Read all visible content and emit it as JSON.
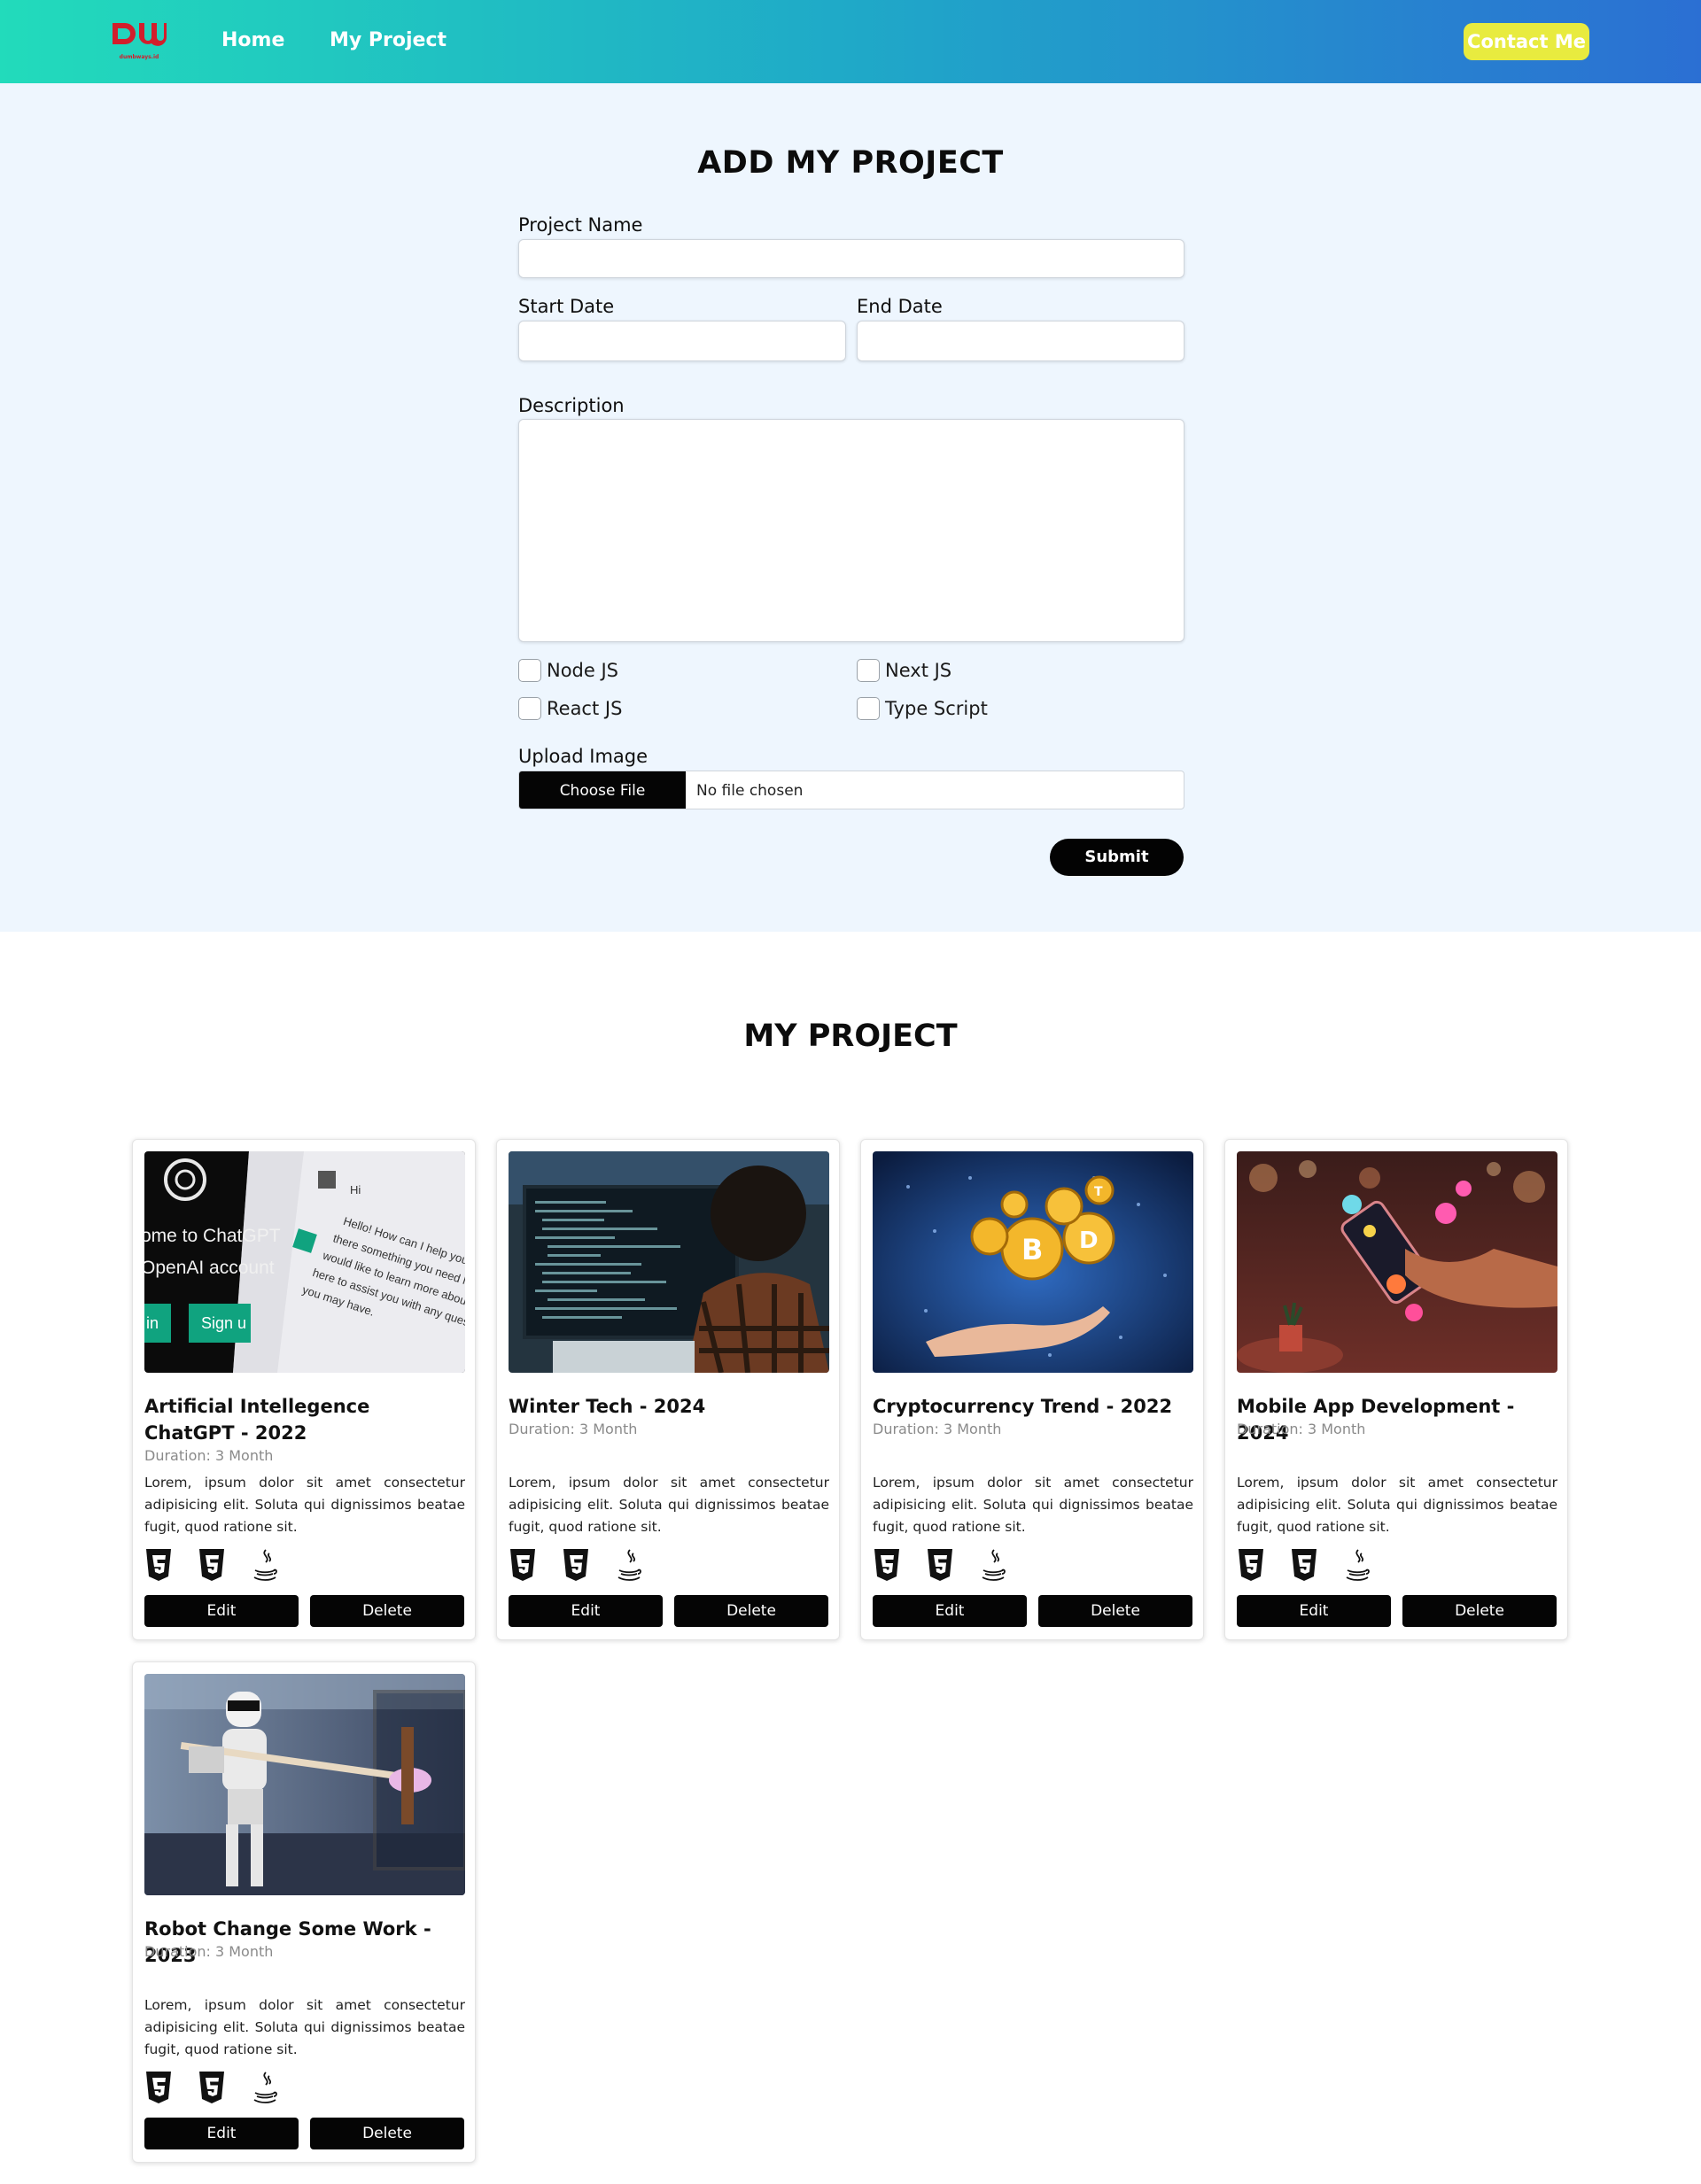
{
  "nav": {
    "logo_text": "dumbways.id",
    "home": "Home",
    "my_project": "My Project",
    "contact": "Contact Me"
  },
  "form": {
    "title": "ADD MY PROJECT",
    "project_name_label": "Project Name",
    "start_date_label": "Start Date",
    "end_date_label": "End Date",
    "description_label": "Description",
    "tech": [
      "Node JS",
      "Next JS",
      "React JS",
      "Type Script"
    ],
    "upload_label": "Upload Image",
    "choose_file": "Choose File",
    "no_file": "No file chosen",
    "submit": "Submit"
  },
  "projects": {
    "title": "MY PROJECT",
    "edit": "Edit",
    "delete": "Delete",
    "tech_icons": [
      "html5-icon",
      "css3-icon",
      "java-icon"
    ],
    "items": [
      {
        "title": "Artificial Intellegence ChatGPT - 2022",
        "duration": "Duration: 3 Month",
        "desc": "Lorem, ipsum dolor sit amet consectetur adipisicing elit. Soluta qui dignissimos beatae fugit, quod ratione sit."
      },
      {
        "title": "Winter Tech - 2024",
        "duration": "Duration: 3 Month",
        "desc": "Lorem, ipsum dolor sit amet consectetur adipisicing elit. Soluta qui dignissimos beatae fugit, quod ratione sit."
      },
      {
        "title": "Cryptocurrency Trend - 2022",
        "duration": "Duration: 3 Month",
        "desc": "Lorem, ipsum dolor sit amet consectetur adipisicing elit. Soluta qui dignissimos beatae fugit, quod ratione sit."
      },
      {
        "title": "Mobile App Development - 2024",
        "duration": "Duration: 3 Month",
        "desc": "Lorem, ipsum dolor sit amet consectetur adipisicing elit. Soluta qui dignissimos beatae fugit, quod ratione sit."
      },
      {
        "title": "Robot Change Some Work - 2023",
        "duration": "Duration: 3 Month",
        "desc": "Lorem, ipsum dolor sit amet consectetur adipisicing elit. Soluta qui dignissimos beatae fugit, quod ratione sit."
      }
    ],
    "chatgpt_image_text": {
      "welcome": "ome to ChatGPT",
      "account": "OpenAI account",
      "login": "in",
      "signup": "Sign u",
      "hi": "Hi",
      "reply": "Hello! How can I help you today? Is there something you need help with or would like to learn more about? I'm here to assist you with any questions you may have."
    }
  }
}
